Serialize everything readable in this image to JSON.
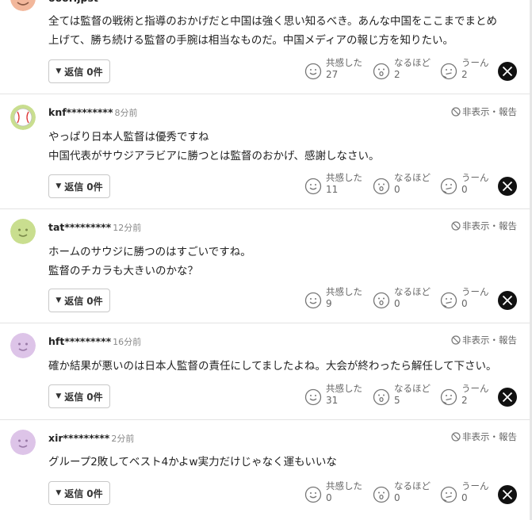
{
  "reply_label": "返信",
  "hide_label": "非表示・報告",
  "reaction_labels": [
    "共感した",
    "なるほど",
    "うーん"
  ],
  "top_comment": {
    "username": "oooHjpst",
    "lines": [
      "全ては監督の戦術と指導のおかげだと中国は強く思い知るべき。あんな中国をここまでまとめ",
      "上げて、勝ち続ける監督の手腕は相当なものだ。中国メディアの報じ方を知りたい。"
    ],
    "reply_count": "0件",
    "counts": [
      "27",
      "2",
      "2"
    ]
  },
  "comments": [
    {
      "username": "knf*********",
      "time": "8分前",
      "avatar": "baseball",
      "lines": [
        "やっぱり日本人監督は優秀ですね",
        "中国代表がサウジアラビアに勝つとは監督のおかげ、感謝しなさい。"
      ],
      "reply_count": "0件",
      "counts": [
        "11",
        "0",
        "0"
      ]
    },
    {
      "username": "tat*********",
      "time": "12分前",
      "avatar": "green",
      "lines": [
        "ホームのサウジに勝つのはすごいですね。",
        "監督のチカラも大きいのかな？"
      ],
      "reply_count": "0件",
      "counts": [
        "9",
        "0",
        "0"
      ]
    },
    {
      "username": "hft*********",
      "time": "16分前",
      "avatar": "purple",
      "lines": [
        "確か結果が悪いのは日本人監督の責任にしてましたよね。大会が終わったら解任して下さい。"
      ],
      "reply_count": "0件",
      "counts": [
        "31",
        "5",
        "2"
      ]
    },
    {
      "username": "xir*********",
      "time": "2分前",
      "avatar": "purple",
      "lines": [
        "グループ2敗してベスト4かよw実力だけじゃなく運もいいな"
      ],
      "reply_count": "0件",
      "counts": [
        "0",
        "0",
        "0"
      ]
    }
  ],
  "colors": {
    "avatar_green": "#c9de8f",
    "avatar_purple": "#ddc4e8",
    "avatar_orange": "#f2b79b",
    "text": "#222222",
    "muted": "#666666",
    "divider": "#e3e3e3"
  }
}
